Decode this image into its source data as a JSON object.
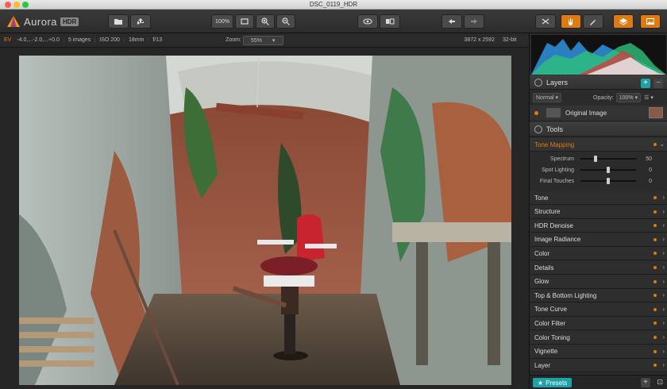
{
  "window": {
    "title": "DSC_0119_HDR"
  },
  "app": {
    "name": "Aurora",
    "badge": "HDR"
  },
  "toolbar": {
    "zoom_fit_label": "100%",
    "active_tool_color": "#e07a10"
  },
  "infobar": {
    "ev_label": "EV",
    "ev_values": "-4.0,...-2.0,...+0.0",
    "images": "5 images",
    "iso": "ISO 200",
    "focal": "18mm",
    "aperture": "f/13",
    "zoom_label": "Zoom:",
    "zoom_value": "55%",
    "dimensions": "3872 x 2592",
    "bitdepth": "32-bit"
  },
  "layers": {
    "header": "Layers",
    "blend_mode": "Normal",
    "opacity_label": "Opacity:",
    "opacity_value": "100%",
    "layer_name": "Original Image"
  },
  "tools": {
    "header": "Tools",
    "active_section": "Tone Mapping",
    "sliders": [
      {
        "label": "Spectrum",
        "value": "50",
        "fraction": 0.25
      },
      {
        "label": "Spot Lighting",
        "value": "0",
        "fraction": 0.5
      },
      {
        "label": "Final Touches",
        "value": "0",
        "fraction": 0.5
      }
    ],
    "sections": [
      "Tone",
      "Structure",
      "HDR Denoise",
      "Image Radiance",
      "Color",
      "Details",
      "Glow",
      "Top & Bottom Lighting",
      "Tone Curve",
      "Color Filter",
      "Color Toning",
      "Vignette",
      "Layer"
    ]
  },
  "bottom": {
    "presets_label": "Presets"
  }
}
